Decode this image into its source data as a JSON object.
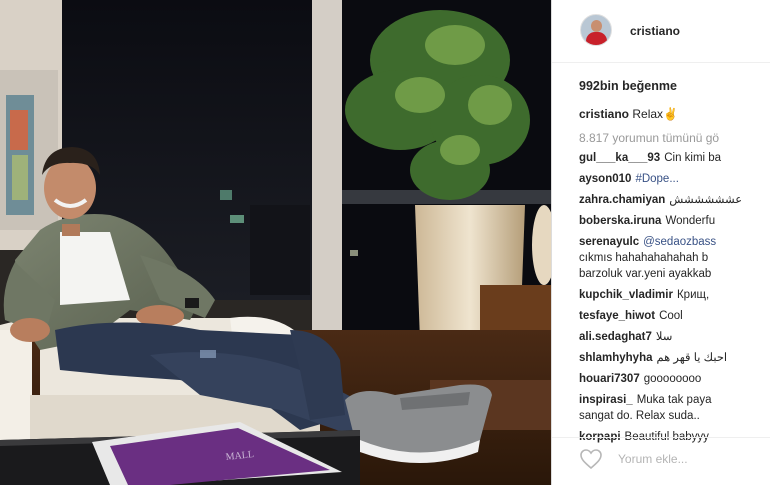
{
  "post": {
    "username": "cristiano",
    "likes": "992bin beğenme",
    "caption_user": "cristiano",
    "caption_text": "Relax✌",
    "view_all": "8.817 yorumun tümünü gö",
    "comments": [
      {
        "user": "gul___ka___93",
        "text": "Cin kimi ba"
      },
      {
        "user": "ayson010",
        "text": "#Dope..."
      },
      {
        "user": "zahra.chamiyan",
        "text": "عشششششش"
      },
      {
        "user": "boberska.iruna",
        "text": "Wonderfu"
      },
      {
        "user": "serenayulc",
        "text": "@sedaozbass",
        "text2": "cıkmıs hahahahahahah b",
        "text3": "barzoluk var.yeni ayakkab"
      },
      {
        "user": "kupchik_vladimir",
        "text": "Крищ,"
      },
      {
        "user": "tesfaye_hiwot",
        "text": "Cool"
      },
      {
        "user": "ali.sedaghat7",
        "text": "سلا"
      },
      {
        "user": "shlamhyhyha",
        "text": "احبك يا قهر هم"
      },
      {
        "user": "houari7307",
        "text": "goooooooo"
      },
      {
        "user": "inspirasi_",
        "text": "Muka tak paya",
        "text2": "sangat do. Relax suda.."
      },
      {
        "user": "korpapi",
        "text": "Beautiful babyyy"
      }
    ],
    "add_comment_placeholder": "Yorum ekle..."
  },
  "photo": {
    "book_text": "MALL"
  },
  "colors": {
    "text": "#262626",
    "muted": "#999999",
    "hashtag": "#385185"
  },
  "icons": [
    "heart-icon"
  ]
}
